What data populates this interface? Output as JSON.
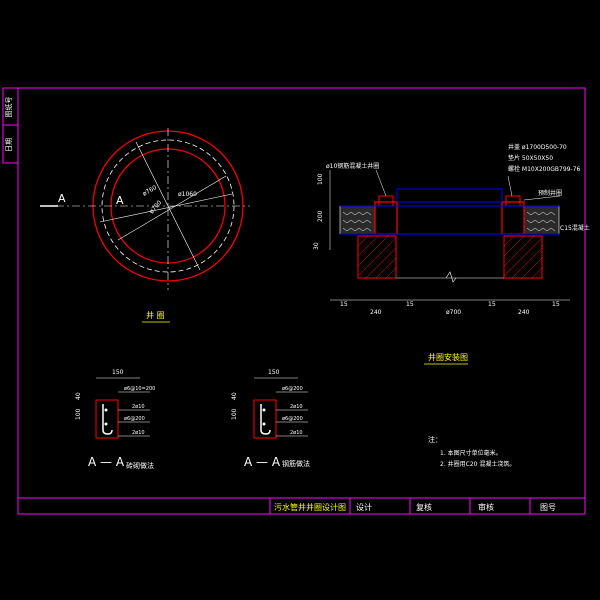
{
  "colors": {
    "background": "#000000",
    "frame": "#ff00ff",
    "line": "#ffffff",
    "ring": "#ff0000",
    "pipe": "#0000ff",
    "label": "#ffff00",
    "dimension": "#00ff00",
    "hatch": "#ff0000"
  },
  "side_strip": {
    "top_label": "图纸号",
    "bottom_label": "日期"
  },
  "plan_view": {
    "caption": "井 圈",
    "section_mark_left": "A",
    "section_mark_inner": "A",
    "dim_outer": "ø1060",
    "dim_mid": "ø760",
    "dim_inner": "ø700"
  },
  "install_view": {
    "caption": "井圈安装图",
    "callout_rebar": "ø10钢筋混凝土井圈",
    "callout_cover": "井盖 ø1700D500-70",
    "callout_pad": "垫片 50X50X50",
    "callout_bolt": "螺栓 M10X200GB799-76",
    "callout_ring": "预制井圈",
    "callout_concrete": "C15混凝土",
    "dims_left_vertical": [
      "100",
      "200",
      "30"
    ],
    "dims_bottom": [
      "15",
      "240",
      "15",
      "ø700",
      "15",
      "240",
      "15"
    ]
  },
  "section_left": {
    "title": "A — A",
    "subtitle": "砖砌做法",
    "dims_top": "150",
    "dim_side_a": "40",
    "dim_side_b": "100",
    "rebar_labels": [
      "ø6@10=200",
      "2ø10",
      "ø6@200",
      "2ø10"
    ]
  },
  "section_right": {
    "title": "A — A",
    "subtitle": "钢筋做法",
    "dims_top": "150",
    "dim_side_a": "40",
    "dim_side_b": "100",
    "rebar_labels": [
      "ø6@200",
      "2ø10",
      "ø6@200",
      "2ø10"
    ]
  },
  "notes": {
    "title": "注：",
    "lines": [
      "1. 本图尺寸单位毫米。",
      "2. 井圈用C20 混凝土浇筑。"
    ]
  },
  "title_block": {
    "drawing_title": "污水管井井圈设计图",
    "design_label": "设计",
    "review_label": "复核",
    "approve_label": "审核",
    "drawing_no_label": "图号"
  }
}
